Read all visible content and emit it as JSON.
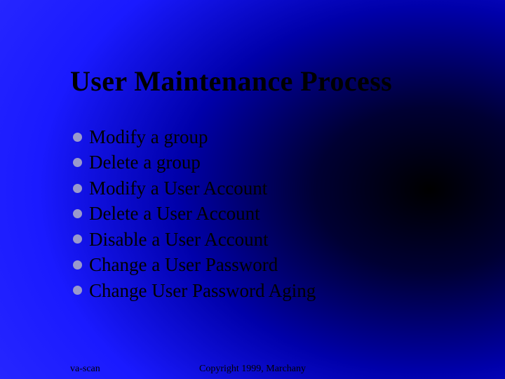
{
  "title": "User Maintenance Process",
  "bullets": [
    "Modify a group",
    "Delete a group",
    "Modify a User Account",
    "Delete a User Account",
    "Disable a User Account",
    "Change a User Password",
    "Change User Password Aging"
  ],
  "footer": {
    "left": "va-scan",
    "center": "Copyright 1999, Marchany"
  }
}
